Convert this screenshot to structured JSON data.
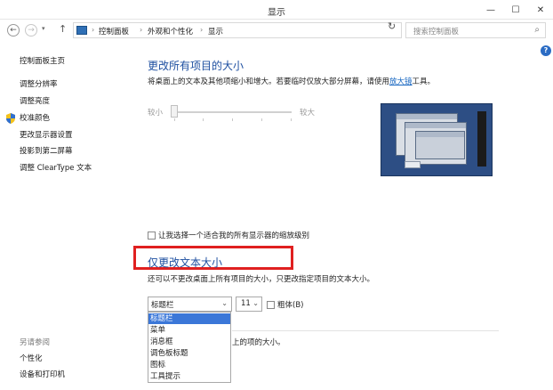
{
  "window": {
    "title": "显示",
    "min_glyph": "—",
    "max_glyph": "☐",
    "close_glyph": "✕"
  },
  "nav": {
    "back_glyph": "←",
    "forward_glyph": "→",
    "dropdown_glyph": "▾",
    "up_glyph": "↑",
    "breadcrumb": [
      "控制面板",
      "外观和个性化",
      "显示"
    ],
    "breadcrumb_sep": "›",
    "address_dropdown_glyph": "▾",
    "refresh_glyph": "↻",
    "search_placeholder": "搜索控制面板",
    "search_glyph": "⌕"
  },
  "sidebar": {
    "home": "控制面板主页",
    "items": [
      "调整分辨率",
      "调整亮度",
      "校准颜色",
      "更改显示器设置",
      "投影到第二屏幕",
      "调整 ClearType 文本"
    ],
    "see_also_title": "另请参阅",
    "see_also_items": [
      "个性化",
      "设备和打印机"
    ]
  },
  "help_glyph": "?",
  "section1": {
    "heading": "更改所有项目的大小",
    "description": "将桌面上的文本及其他项缩小和增大。若要临时仅放大部分屏幕，请使用",
    "link": "放大镜",
    "description_end": "工具。",
    "slider_min": "较小",
    "slider_max": "较大",
    "slider_value": 0
  },
  "checkbox_text": "让我选择一个适合我的所有显示器的缩放级别",
  "section2": {
    "heading": "仅更改文本大小",
    "description": "还可以不更改桌面上所有项目的大小，只更改指定项目的文本大小。",
    "item_select_value": "标题栏",
    "size_select_value": "11",
    "select_arrow_glyph": "⌄",
    "bold_label": "粗体(B)",
    "dropdown_options": [
      "标题栏",
      "菜单",
      "消息框",
      "调色板标题",
      "图标",
      "工具提示"
    ],
    "selected_index": 0,
    "partial_text": "上的项的大小。"
  },
  "colors": {
    "heading": "#1e4fa0",
    "link": "#1565c0",
    "highlight_box": "#e02020",
    "selection": "#3b77d8"
  }
}
